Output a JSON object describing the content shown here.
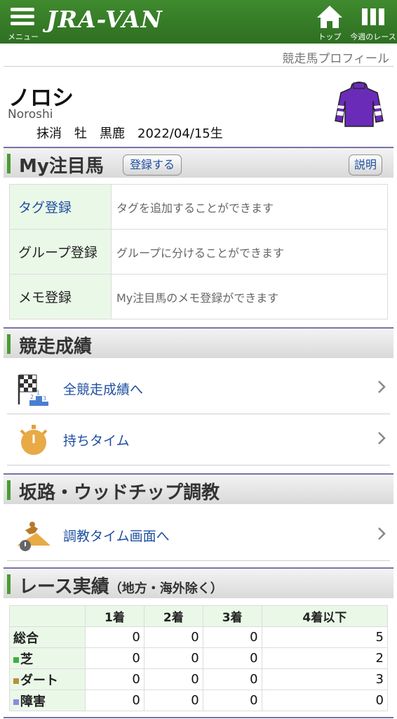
{
  "header": {
    "menu_label": "メニュー",
    "logo": "JRA-VAN",
    "top_label": "トップ",
    "week_label": "今週のレース",
    "brand_color": "#2e6f22"
  },
  "breadcrumb": "競走馬プロフィール",
  "horse": {
    "name": "ノロシ",
    "roman": "Noroshi",
    "status": "抹消",
    "sex": "牡",
    "color": "黒鹿",
    "birth": "2022/04/15生"
  },
  "my_watch": {
    "title": "My注目馬",
    "register_button": "登録する",
    "help_button": "説明",
    "rows": [
      {
        "key": "タグ登録",
        "desc": "タグを追加することができます"
      },
      {
        "key": "グループ登録",
        "desc": "グループに分けることができます"
      },
      {
        "key": "メモ登録",
        "desc": "My注目馬のメモ登録ができます"
      }
    ]
  },
  "race_record": {
    "title": "競走成績",
    "links": [
      {
        "label": "全競走成績へ",
        "icon": "checkered-flag-podium-icon"
      },
      {
        "label": "持ちタイム",
        "icon": "stopwatch-icon"
      }
    ]
  },
  "training": {
    "title": "坂路・ウッドチップ調教",
    "links": [
      {
        "label": "調教タイム画面へ",
        "icon": "training-horse-icon"
      }
    ]
  },
  "results": {
    "title": "レース実績",
    "subtitle": "（地方・海外除く）",
    "columns": [
      "",
      "1着",
      "2着",
      "3着",
      "4着以下"
    ],
    "rows": [
      {
        "label": "総合",
        "values": [
          "0",
          "0",
          "0",
          "5"
        ],
        "marker": ""
      },
      {
        "label": "芝",
        "values": [
          "0",
          "0",
          "0",
          "2"
        ],
        "marker": "#3fae3f"
      },
      {
        "label": "ダート",
        "values": [
          "0",
          "0",
          "0",
          "3"
        ],
        "marker": "#b8913a"
      },
      {
        "label": "障害",
        "values": [
          "0",
          "0",
          "0",
          "0"
        ],
        "marker": "#8c8cdc"
      }
    ]
  }
}
